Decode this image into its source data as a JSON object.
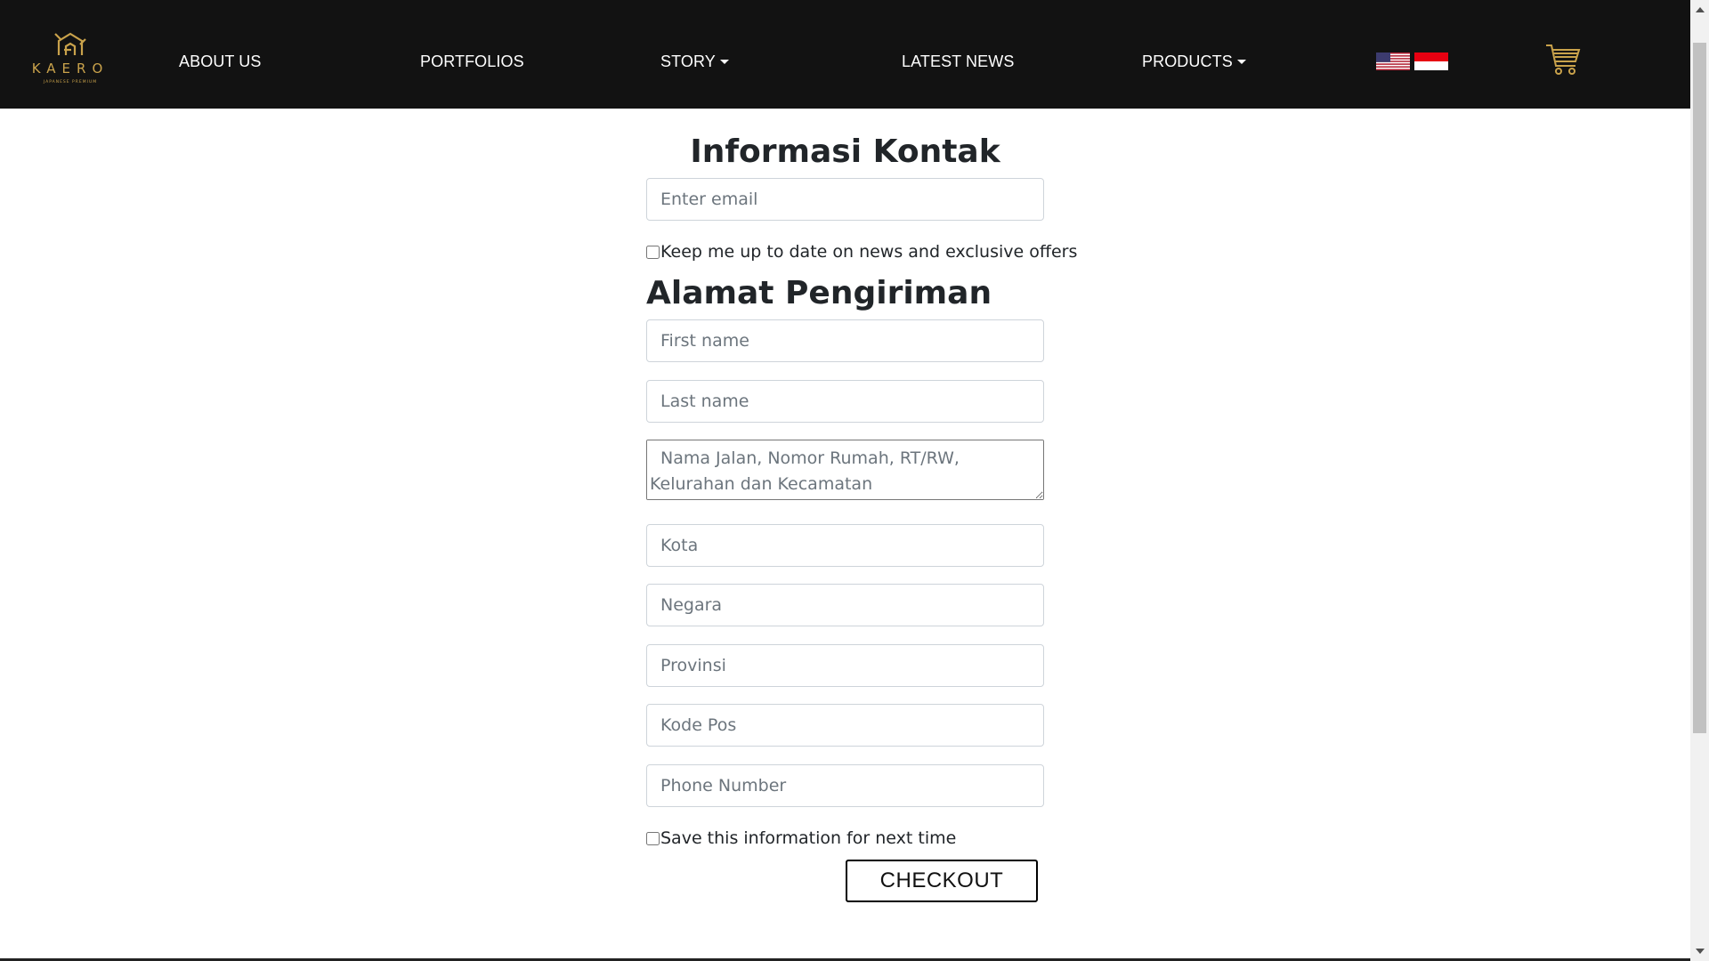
{
  "brand": {
    "name": "KAERO",
    "tagline": "JAPANESE PREMIUM",
    "gold": "#c9a24b"
  },
  "nav": {
    "items": [
      {
        "label": "ABOUT US",
        "dropdown": false
      },
      {
        "label": "PORTFOLIOS",
        "dropdown": false
      },
      {
        "label": "STORY",
        "dropdown": true
      },
      {
        "label": "LATEST NEWS",
        "dropdown": false
      },
      {
        "label": "PRODUCTS",
        "dropdown": true
      }
    ],
    "flags": [
      "us-flag-icon",
      "indonesia-flag-icon"
    ],
    "cart_icon": "cart-icon"
  },
  "contact": {
    "title": "Informasi Kontak",
    "email_placeholder": "Enter email",
    "newsletter_label": "Keep me up to date on news and exclusive offers",
    "newsletter_checked": false
  },
  "shipping": {
    "title": "Alamat Pengiriman",
    "first_name_placeholder": "First name",
    "last_name_placeholder": "Last name",
    "address_placeholder": "Nama Jalan, Nomor Rumah, RT/RW, Kelurahan dan Kecamatan",
    "city_placeholder": "Kota",
    "country_placeholder": "Negara",
    "province_placeholder": "Provinsi",
    "postal_placeholder": "Kode Pos",
    "phone_placeholder": "Phone Number",
    "save_label": "Save this information for next time",
    "save_checked": false
  },
  "checkout_label": "CHECKOUT"
}
